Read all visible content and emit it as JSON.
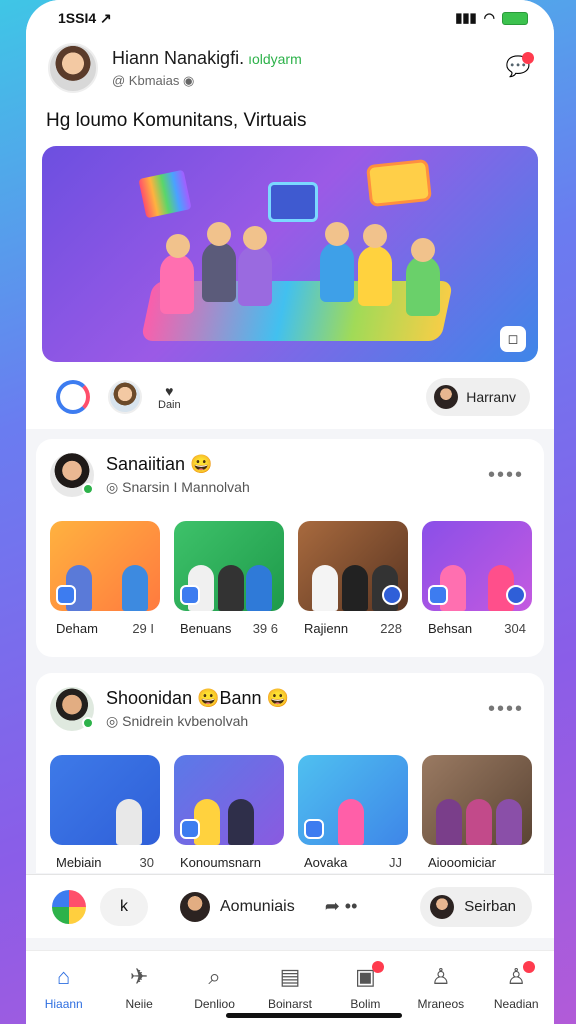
{
  "status": {
    "time": "1SSI4 ↗"
  },
  "profile": {
    "name": "Hiann Nanakigfi.",
    "tag": "ıoldyarm",
    "handle": "@ Kbmaias"
  },
  "headline": "Hg loumo Komunitans, Virtuais",
  "action_row": {
    "reaction_label": "Dain",
    "pill_label": "Harranv"
  },
  "sections": [
    {
      "title": "Sanaiitian 😀",
      "subtitle": "Snarsin I Mannolvah",
      "cards": [
        {
          "label": "Deham",
          "count": "29 I"
        },
        {
          "label": "Benuans",
          "count": "39 6"
        },
        {
          "label": "Rajienn",
          "count": "228"
        },
        {
          "label": "Behsan",
          "count": "304"
        }
      ]
    },
    {
      "title": "Shoonidan 😀Bann 😀",
      "subtitle": "Snidrein kvbenolvah",
      "cards": [
        {
          "label": "Mebiain",
          "count": "30"
        },
        {
          "label": "Konoumsnarn",
          "count": ""
        },
        {
          "label": "Aovaka",
          "count": "JJ"
        },
        {
          "label": "Aiooomiciar",
          "count": ""
        }
      ]
    }
  ],
  "bottom_action": {
    "k_label": "k",
    "pill_label": "Aomuniais",
    "search_label": "Seirban"
  },
  "tabs": [
    {
      "label": "Hiaann",
      "icon": "home-icon"
    },
    {
      "label": "Neiie",
      "icon": "explore-icon"
    },
    {
      "label": "Denlioo",
      "icon": "search-icon"
    },
    {
      "label": "Boinarst",
      "icon": "store-icon"
    },
    {
      "label": "Bolim",
      "icon": "bell-icon"
    },
    {
      "label": "Mraneos",
      "icon": "profile-icon"
    },
    {
      "label": "Neadian",
      "icon": "chat-icon"
    }
  ]
}
